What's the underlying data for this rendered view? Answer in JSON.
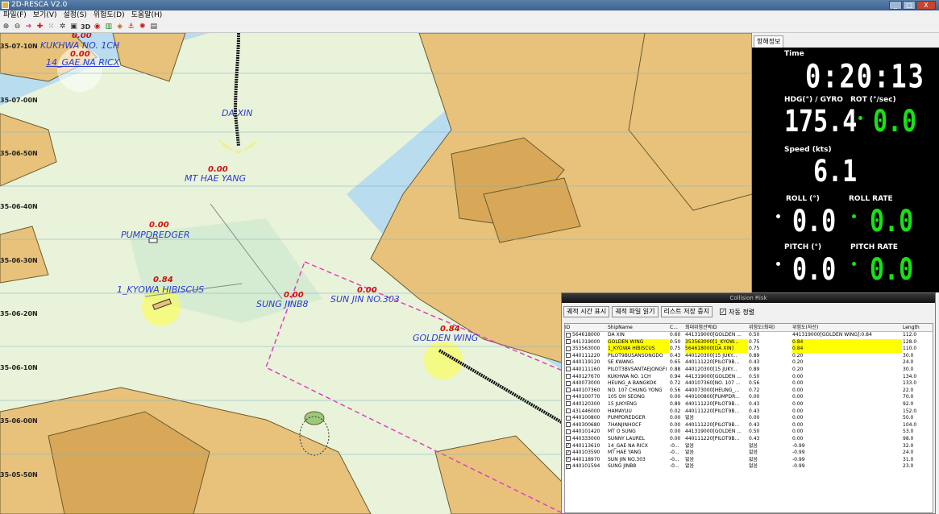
{
  "window": {
    "title": "2D-RESCA V2.0",
    "buttons": [
      "_",
      "□",
      "X"
    ]
  },
  "menu": [
    "파일(F)",
    "보기(V)",
    "설정(S)",
    "위험도(D)",
    "도움말(H)"
  ],
  "toolbar": {
    "buttons": [
      "zoom-in-icon",
      "zoom-out-icon",
      "arrow-right-icon",
      "marker-icon",
      "dotted-grid-icon",
      "gear-icon",
      "screen-icon",
      "3D",
      "record-icon",
      "chart-icon",
      "route-icon",
      "anchor-icon",
      "alert-icon",
      "list-icon"
    ],
    "label_3d": "3D"
  },
  "map": {
    "lat_labels": [
      "35-07-10N",
      "35-07-00N",
      "35-06-50N",
      "35-06-40N",
      "35-06-30N",
      "35-06-20N",
      "35-06-10N",
      "35-06-00N",
      "35-05-50N"
    ],
    "ships": [
      {
        "name": "KUKHWA NO. 1CH",
        "risk": "0.00"
      },
      {
        "name": "14_GAE NA RICX",
        "risk": "0.00"
      },
      {
        "name": "DA XIN",
        "risk": ""
      },
      {
        "name": "MT HAE YANG",
        "risk": "0.00"
      },
      {
        "name": "PUMPDREDGER",
        "risk": "0.00"
      },
      {
        "name": "1_KYOWA HIBISCUS",
        "risk": "0.84"
      },
      {
        "name": "SUNG JINB8",
        "risk": "0.00"
      },
      {
        "name": "SUN JIN NO.303",
        "risk": "0.00"
      },
      {
        "name": "GOLDEN WING",
        "risk": "0.84"
      }
    ]
  },
  "nav": {
    "tab": "항해정보",
    "time_label": "Time",
    "time": "0:20:13",
    "hdg_label": "HDG(°) / GYRO",
    "hdg": "175.4",
    "rot_label": "ROT (°/sec)",
    "rot": "0.0",
    "speed_label": "Speed (kts)",
    "speed": "6.1",
    "roll_label": "ROLL (°)",
    "roll": "0.0",
    "rollrate_label": "ROLL RATE",
    "rollrate": "0.0",
    "pitch_label": "PITCH (°)",
    "pitch": "0.0",
    "pitchrate_label": "PITCH RATE",
    "pitchrate": "0.0",
    "colors": {
      "white": "#ffffff",
      "green": "#18e018"
    }
  },
  "risk_panel": {
    "title": "Collision Risk",
    "buttons": [
      "궤적 시간 표시",
      "궤적 파일 읽기",
      "리스트 저장 중지"
    ],
    "autosort": "자동 정렬",
    "columns": [
      "ID",
      "ShipName",
      "C...",
      "최대위험선박ID",
      "위험도(최대)",
      "위험도(자선)",
      "Length"
    ],
    "rows": [
      {
        "checked": false,
        "hl": false,
        "cells": [
          "564618000",
          "DA XIN",
          "0.60",
          "441319000[GOLDEN ...",
          "0.50",
          "441319000[GOLDEN WING]:0.84",
          "112.0"
        ]
      },
      {
        "checked": false,
        "hl": true,
        "cells": [
          "441319000",
          "GOLDEN WING",
          "0.50",
          "353563000[1_KYOW...",
          "0.75",
          "0.84",
          "128.0"
        ]
      },
      {
        "checked": false,
        "hl": true,
        "cells": [
          "353563000",
          "1_KYOWA HIBISCUS",
          "0.75",
          "564618000[DA XIN]",
          "0.75",
          "0.84",
          "110.0"
        ]
      },
      {
        "checked": false,
        "hl": false,
        "cells": [
          "440111220",
          "PILOT9BUSANSONGDO",
          "0.43",
          "440120300[15 JUKY...",
          "0.89",
          "0.20",
          "30.0"
        ]
      },
      {
        "checked": false,
        "hl": false,
        "cells": [
          "440119120",
          "SE KWANG",
          "0.65",
          "440111220[PILOT9B...",
          "0.43",
          "0.20",
          "24.0"
        ]
      },
      {
        "checked": false,
        "hl": false,
        "cells": [
          "440111160",
          "PILOT3BVSANTAEJONGFI",
          "0.88",
          "440120300[15 JUKY...",
          "0.89",
          "0.20",
          "30.0"
        ]
      },
      {
        "checked": false,
        "hl": false,
        "cells": [
          "440127670",
          "KUKHWA NO. 1CH",
          "0.94",
          "441319000[GOLDEN ...",
          "0.50",
          "0.00",
          "134.0"
        ]
      },
      {
        "checked": false,
        "hl": false,
        "cells": [
          "440073000",
          "HEUNG_A BANGKOK",
          "0.72",
          "440107360[NO. 107 ...",
          "0.56",
          "0.00",
          "133.0"
        ]
      },
      {
        "checked": false,
        "hl": false,
        "cells": [
          "440107360",
          "NO. 107 CHUNG YONG",
          "0.56",
          "440073000[HEUNG_...",
          "0.72",
          "0.00",
          "22.0"
        ]
      },
      {
        "checked": false,
        "hl": false,
        "cells": [
          "440100770",
          "105 OH SEONG",
          "0.00",
          "440100800[PUMPDR...",
          "0.00",
          "0.00",
          "70.0"
        ]
      },
      {
        "checked": false,
        "hl": false,
        "cells": [
          "440120300",
          "15 JUKYENG",
          "0.89",
          "440111220[PILOT9B...",
          "0.43",
          "0.00",
          "92.0"
        ]
      },
      {
        "checked": false,
        "hl": false,
        "cells": [
          "431446000",
          "HAMAYUU",
          "0.02",
          "440111220[PILOT9B...",
          "0.43",
          "0.00",
          "152.0"
        ]
      },
      {
        "checked": false,
        "hl": false,
        "cells": [
          "440100800",
          "PUMPDREDGER",
          "0.00",
          "없음",
          "0.00",
          "0.00",
          "50.0"
        ]
      },
      {
        "checked": false,
        "hl": false,
        "cells": [
          "440300680",
          "7HANJINHOCF",
          "0.00",
          "440111220[PILOT9B...",
          "0.43",
          "0.00",
          "104.0"
        ]
      },
      {
        "checked": false,
        "hl": false,
        "cells": [
          "440101420",
          "MT O SUNG",
          "0.00",
          "441319000[GOLDEN ...",
          "0.50",
          "0.00",
          "53.0"
        ]
      },
      {
        "checked": false,
        "hl": false,
        "cells": [
          "440333000",
          "SUNNY LAUREL",
          "0.00",
          "440111220[PILOT9B...",
          "0.43",
          "0.00",
          "98.0"
        ]
      },
      {
        "checked": true,
        "hl": false,
        "cells": [
          "440113610",
          "14_GAE NA RICX",
          "-0...",
          "없음",
          "없음",
          "-0.99",
          "32.0"
        ]
      },
      {
        "checked": true,
        "hl": false,
        "cells": [
          "440103590",
          "MT HAE YANG",
          "-0...",
          "없음",
          "없음",
          "-0.99",
          "24.0"
        ]
      },
      {
        "checked": true,
        "hl": false,
        "cells": [
          "440118970",
          "SUN JIN NO.303",
          "-0...",
          "없음",
          "없음",
          "-0.99",
          "31.0"
        ]
      },
      {
        "checked": true,
        "hl": false,
        "cells": [
          "440101594",
          "SUNG JINB8",
          "-0...",
          "없음",
          "없음",
          "-0.99",
          "23.0"
        ]
      }
    ]
  }
}
